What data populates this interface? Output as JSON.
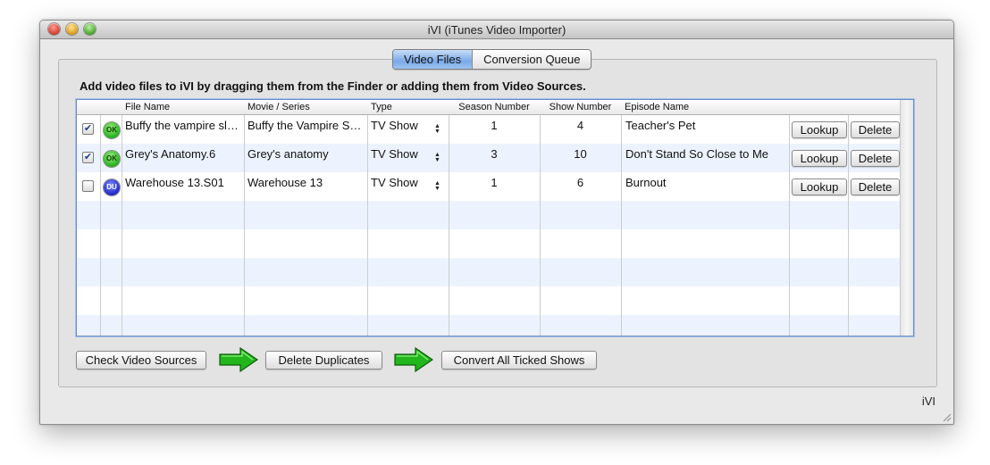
{
  "window": {
    "title": "iVI (iTunes Video Importer)"
  },
  "tabs": [
    {
      "label": "Video Files",
      "active": true
    },
    {
      "label": "Conversion Queue",
      "active": false
    }
  ],
  "instruction": "Add video files to iVI by dragging them from the Finder or adding them from Video Sources.",
  "table": {
    "columns": [
      "File Name",
      "Movie / Series",
      "Type",
      "Season Number",
      "Show Number",
      "Episode Name"
    ],
    "lookup_label": "Lookup",
    "delete_label": "Delete",
    "rows": [
      {
        "checked": true,
        "status": "OK",
        "file": "Buffy the vampire slayer",
        "series": "Buffy the Vampire Slayer",
        "type": "TV Show",
        "season": "1",
        "show": "4",
        "episode": "Teacher's Pet"
      },
      {
        "checked": true,
        "status": "OK",
        "file": "Grey's Anatomy.6",
        "series": "Grey's anatomy",
        "type": "TV Show",
        "season": "3",
        "show": "10",
        "episode": "Don't Stand So Close to Me"
      },
      {
        "checked": false,
        "status": "DU",
        "file": "Warehouse 13.S01",
        "series": "Warehouse 13",
        "type": "TV Show",
        "season": "1",
        "show": "6",
        "episode": "Burnout"
      }
    ]
  },
  "footer": {
    "check_sources_label": "Check Video Sources",
    "delete_duplicates_label": "Delete Duplicates",
    "convert_label": "Convert All Ticked Shows"
  },
  "status_label": "iVI",
  "colors": {
    "ok": "#23b01c",
    "duplicate": "#2228c4",
    "tab_active": "#7aaae8",
    "arrow": "#22b51c"
  }
}
